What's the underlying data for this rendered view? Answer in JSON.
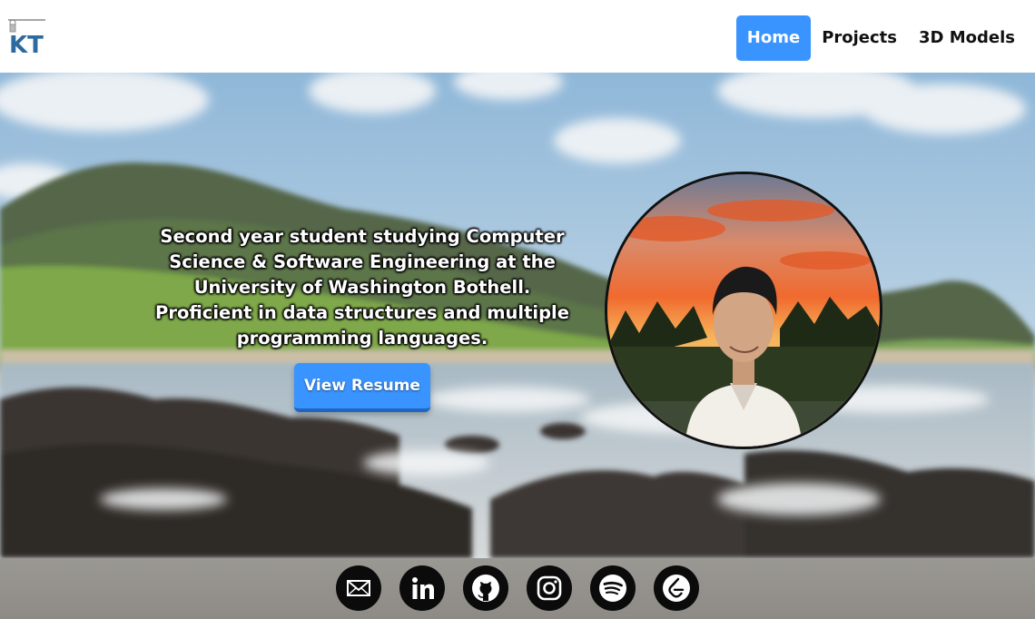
{
  "header": {
    "logo_text": "KT",
    "nav": [
      {
        "label": "Home",
        "active": true
      },
      {
        "label": "Projects",
        "active": false
      },
      {
        "label": "3D Models",
        "active": false
      }
    ]
  },
  "hero": {
    "bio": "Second year student studying Computer Science & Software Engineering at the University of Washington Bothell. Proficient in data structures and multiple programming languages.",
    "resume_label": "View Resume",
    "profile_photo": "profile-photo-sunset"
  },
  "footer": {
    "socials": [
      {
        "icon": "mail-icon"
      },
      {
        "icon": "linkedin-icon"
      },
      {
        "icon": "github-icon"
      },
      {
        "icon": "instagram-icon"
      },
      {
        "icon": "spotify-icon"
      },
      {
        "icon": "leetcode-icon"
      }
    ]
  },
  "colors": {
    "accent": "#3a94ff",
    "logo_blue": "#2d6aa0"
  }
}
